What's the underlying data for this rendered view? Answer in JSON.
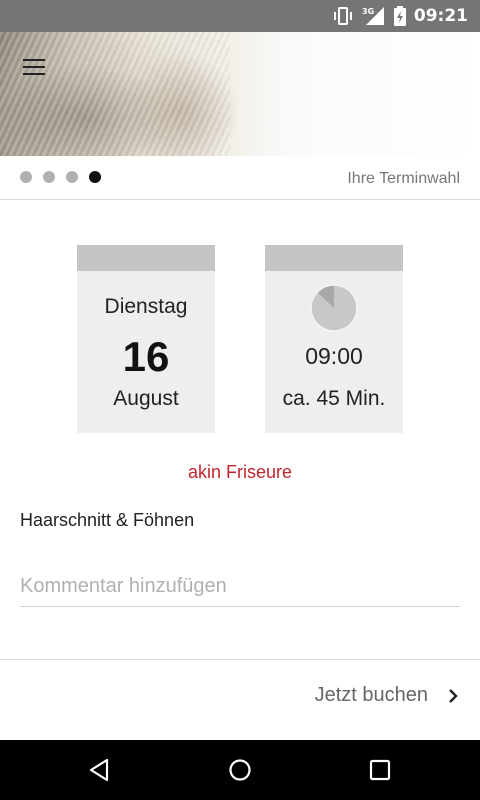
{
  "status_bar": {
    "time": "09:21",
    "network": "3G",
    "icons": [
      "vibrate-icon",
      "signal-3g-icon",
      "battery-charging-icon"
    ]
  },
  "header": {
    "menu_icon": "hamburger-menu-icon",
    "pager": {
      "total": 4,
      "active_index": 3
    },
    "step_label": "Ihre Terminwahl"
  },
  "appointment": {
    "date": {
      "weekday": "Dienstag",
      "day": "16",
      "month": "August"
    },
    "time": {
      "start": "09:00",
      "duration": "ca. 45 Min.",
      "clock_icon": "clock-icon"
    },
    "salon": "akin Friseure",
    "service": "Haarschnitt & Föhnen"
  },
  "comment": {
    "placeholder": "Kommentar hinzufügen",
    "value": ""
  },
  "footer": {
    "book_label": "Jetzt buchen",
    "chevron_icon": "chevron-right-icon"
  },
  "nav_bar": {
    "icons": [
      "back-icon",
      "home-icon",
      "recents-icon"
    ]
  },
  "colors": {
    "accent": "#c0262b",
    "card_bg": "#eeeeee",
    "card_cap": "#c4c4c4",
    "status_bar": "#757575"
  }
}
